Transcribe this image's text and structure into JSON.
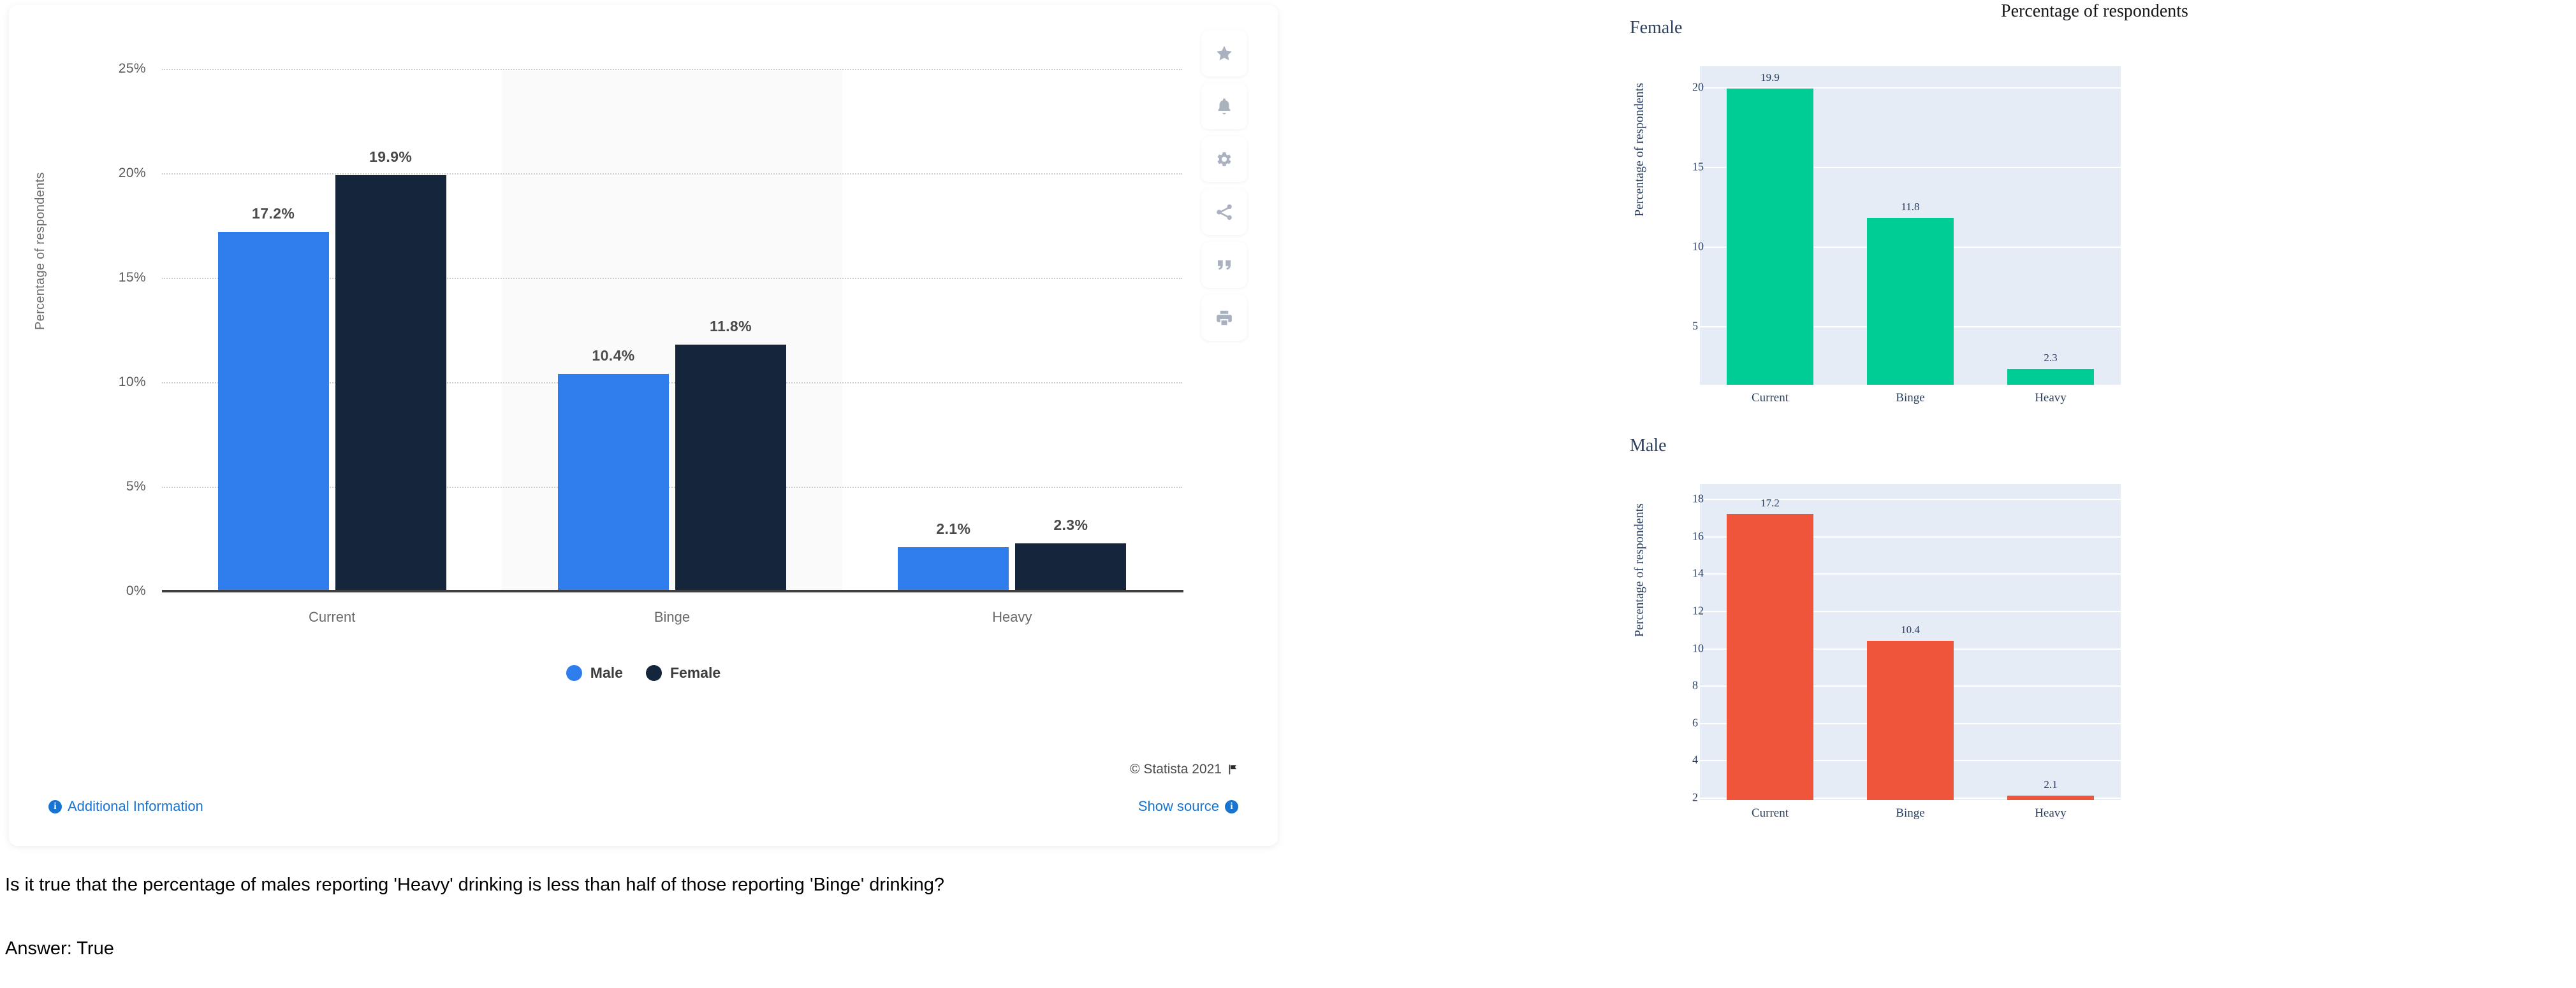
{
  "main_chart": {
    "ylabel": "Percentage of respondents",
    "ytick_labels": [
      "0%",
      "5%",
      "10%",
      "15%",
      "20%",
      "25%"
    ],
    "categories": [
      "Current",
      "Binge",
      "Heavy"
    ],
    "bar_labels": {
      "male": [
        "17.2%",
        "10.4%",
        "2.1%"
      ],
      "female": [
        "19.9%",
        "11.8%",
        "2.3%"
      ]
    },
    "legend": [
      {
        "label": "Male",
        "color": "#2f7ded",
        "icon": "legend-dot-male"
      },
      {
        "label": "Female",
        "color": "#15253c",
        "icon": "legend-dot-female"
      }
    ],
    "copyright": "© Statista 2021",
    "additional_information": "Additional Information",
    "show_source": "Show source",
    "info_glyph": "i"
  },
  "toolbar": {
    "buttons": [
      {
        "name": "star-icon",
        "title": "Favorite"
      },
      {
        "name": "bell-icon",
        "title": "Notifications"
      },
      {
        "name": "gear-icon",
        "title": "Settings"
      },
      {
        "name": "share-icon",
        "title": "Share"
      },
      {
        "name": "quote-icon",
        "title": "Cite"
      },
      {
        "name": "print-icon",
        "title": "Print"
      }
    ]
  },
  "right_panel": {
    "title": "Percentage of respondents",
    "facets": [
      {
        "subtitle": "Female",
        "ylabel": "Percentage of respondents"
      },
      {
        "subtitle": "Male",
        "ylabel": "Percentage of respondents"
      }
    ]
  },
  "qa": {
    "question": "Is it true that the percentage of males reporting 'Heavy' drinking is less than half of those reporting 'Binge' drinking?",
    "answer": "Answer: True"
  },
  "chart_data": [
    {
      "type": "bar",
      "id": "statista-grouped-bar",
      "title": "",
      "xlabel": "",
      "ylabel": "Percentage of respondents",
      "categories": [
        "Current",
        "Binge",
        "Heavy"
      ],
      "series": [
        {
          "name": "Male",
          "color": "#2f7ded",
          "values": [
            17.2,
            10.4,
            2.1
          ],
          "labels": [
            "17.2%",
            "10.4%",
            "2.1%"
          ]
        },
        {
          "name": "Female",
          "color": "#15253c",
          "values": [
            19.9,
            11.8,
            2.3
          ],
          "labels": [
            "19.9%",
            "11.8%",
            "2.3%"
          ]
        }
      ],
      "ylim": [
        0,
        25
      ],
      "yticks": [
        0,
        5,
        10,
        15,
        20,
        25
      ],
      "ytick_labels": [
        "0%",
        "5%",
        "10%",
        "15%",
        "20%",
        "25%"
      ],
      "grid": true,
      "legend_position": "bottom"
    },
    {
      "type": "bar",
      "id": "facet-female",
      "title": "Percentage of respondents",
      "subtitle": "Female",
      "xlabel": "",
      "ylabel": "Percentage of respondents",
      "categories": [
        "Current",
        "Binge",
        "Heavy"
      ],
      "values": [
        19.9,
        11.8,
        2.3
      ],
      "labels": [
        "19.9",
        "11.8",
        "2.3"
      ],
      "color": "#00cc96",
      "ylim": [
        1.3,
        21.3
      ],
      "yticks": [
        5,
        10,
        15,
        20
      ],
      "ytick_labels": [
        "5",
        "10",
        "15",
        "20"
      ],
      "grid": true,
      "legend_position": "none"
    },
    {
      "type": "bar",
      "id": "facet-male",
      "title": "Percentage of respondents",
      "subtitle": "Male",
      "xlabel": "",
      "ylabel": "Percentage of respondents",
      "categories": [
        "Current",
        "Binge",
        "Heavy"
      ],
      "values": [
        17.2,
        10.4,
        2.1
      ],
      "labels": [
        "17.2",
        "10.4",
        "2.1"
      ],
      "color": "#ef553b",
      "ylim": [
        1.85,
        18.8
      ],
      "yticks": [
        2,
        4,
        6,
        8,
        10,
        12,
        14,
        16,
        18
      ],
      "ytick_labels": [
        "2",
        "4",
        "6",
        "8",
        "10",
        "12",
        "14",
        "16",
        "18"
      ],
      "grid": true,
      "legend_position": "none"
    }
  ]
}
